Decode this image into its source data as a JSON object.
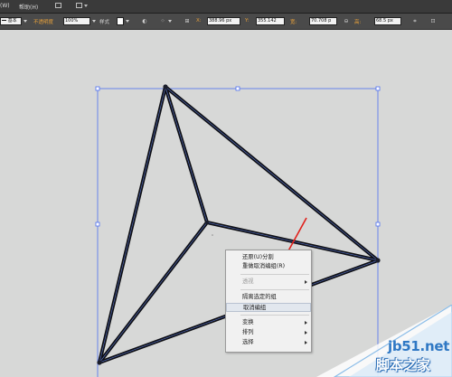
{
  "menubar": {
    "items": [
      "(W)",
      "帮助(H)"
    ]
  },
  "controlbar": {
    "brush_label": "基本",
    "opacity_label": "不透明度",
    "opacity_value": "100%",
    "style_label": "样式",
    "x_label": "X:",
    "x_value": "388.96 px",
    "y_label": "Y:",
    "y_value": "355.142",
    "w_label": "宽:",
    "w_value": "70.708 p",
    "h_label": "高:",
    "h_value": "68.5 px"
  },
  "context_menu": {
    "items": [
      {
        "label": "还原(U)分割",
        "disabled": false,
        "submenu": false
      },
      {
        "label": "重做取消编组(R)",
        "disabled": false,
        "submenu": false
      },
      {
        "label": "透视",
        "disabled": true,
        "submenu": true
      },
      {
        "label": "隔离选定的组",
        "disabled": false,
        "submenu": false
      },
      {
        "label": "取消编组",
        "disabled": false,
        "submenu": false,
        "highlighted": true
      },
      {
        "label": "变换",
        "disabled": false,
        "submenu": true
      },
      {
        "label": "排列",
        "disabled": false,
        "submenu": true
      },
      {
        "label": "选择",
        "disabled": false,
        "submenu": true
      }
    ]
  },
  "watermark": {
    "line1": "jb51.net",
    "line2": "脚本之家"
  },
  "colors": {
    "canvas": "#d7d8d7",
    "selection": "#4d6ff0",
    "annotation_arrow": "#e0201b",
    "watermark_blue": "#2f78c4"
  }
}
